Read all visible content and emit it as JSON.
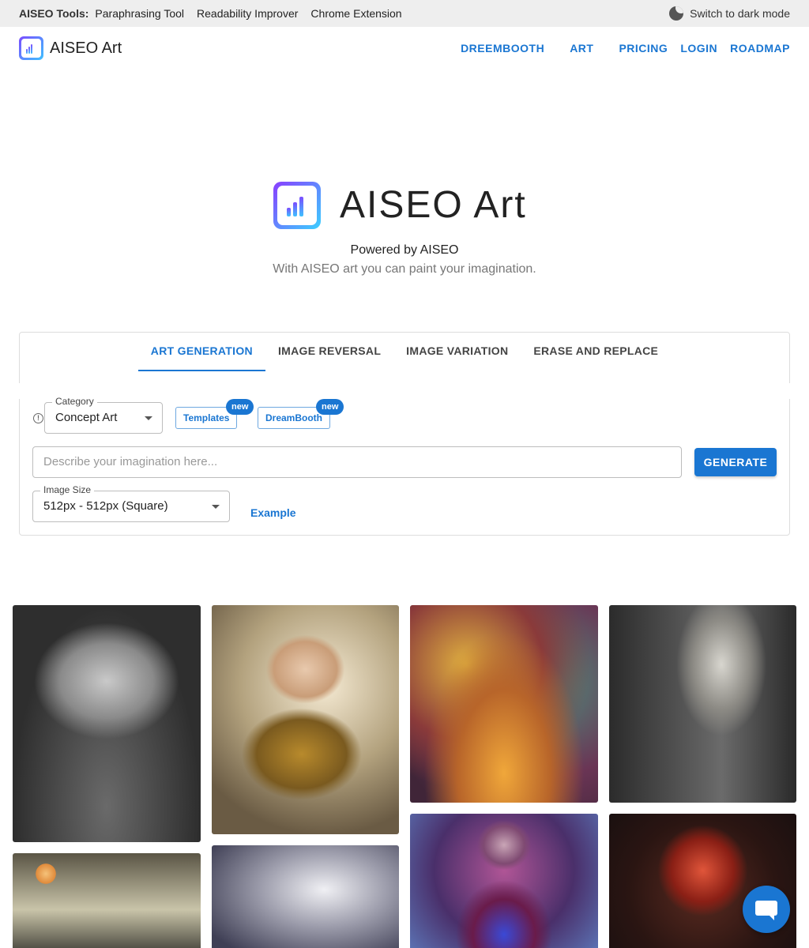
{
  "tools_bar": {
    "lead": "AISEO Tools:",
    "tools": [
      "Paraphrasing Tool",
      "Readability Improver",
      "Chrome Extension"
    ],
    "dark_mode_label": "Switch to dark mode",
    "dark_mode_icon": "moon-icon"
  },
  "header": {
    "brand": "AISEO Art",
    "logo_icon": "aiseo-logo-icon",
    "nav": [
      "DREEMBOOTH",
      "ART",
      "PRICING",
      "LOGIN",
      "ROADMAP"
    ]
  },
  "hero": {
    "title": "AISEO Art",
    "powered_by": "Powered by AISEO",
    "tagline": "With AISEO art you can paint your imagination."
  },
  "tabs": [
    "ART GENERATION",
    "IMAGE REVERSAL",
    "IMAGE VARIATION",
    "ERASE AND REPLACE"
  ],
  "active_tab": "ART GENERATION",
  "form": {
    "category_label": "Category",
    "category_value": "Concept Art",
    "templates_label": "Templates",
    "dreambooth_label": "DreamBooth",
    "new_badge": "new",
    "prompt_placeholder": "Describe your imagination here...",
    "generate_label": "GENERATE",
    "image_size_label": "Image Size",
    "image_size_value": "512px - 512px (Square)",
    "example_label": "Example"
  },
  "colors": {
    "accent": "#1a76d2",
    "toolbar_bg": "#eeeeee"
  },
  "chat_icon": "chat-bubble-icon"
}
